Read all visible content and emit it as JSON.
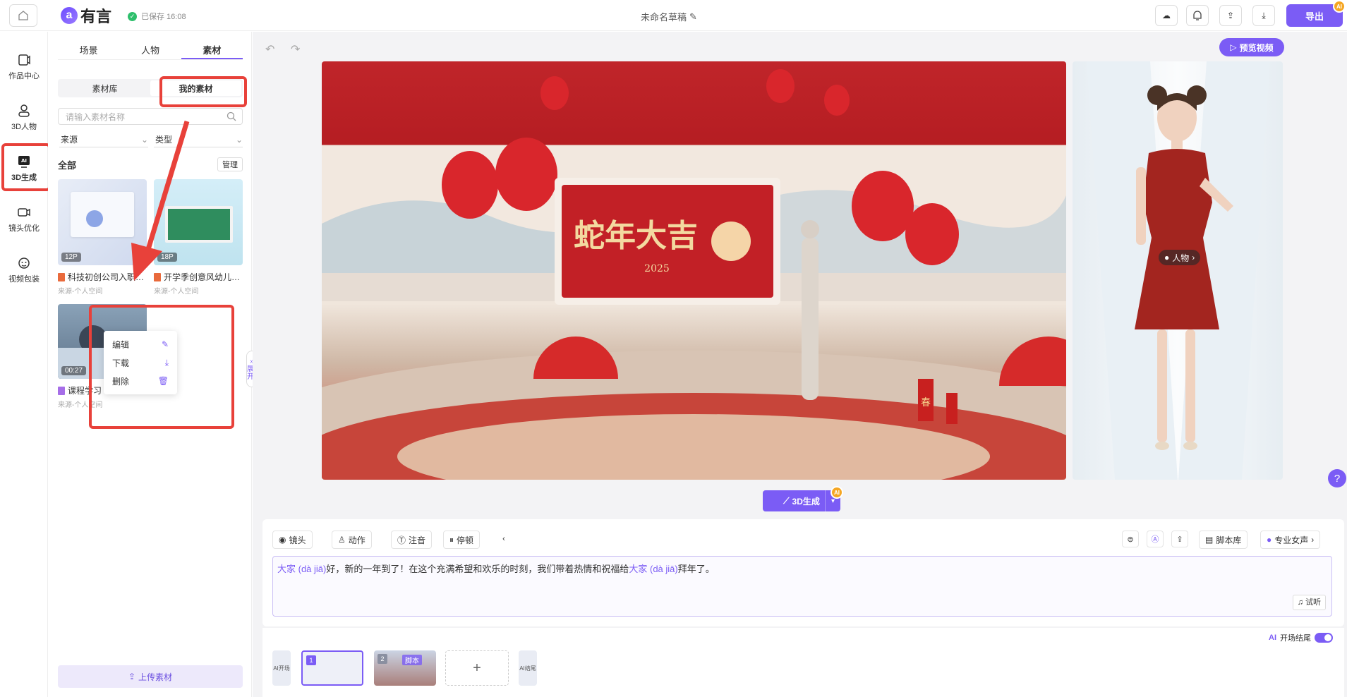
{
  "app": {
    "name": "有言",
    "saved_status": "已保存 16:08",
    "doc_title": "未命名草稿",
    "export_label": "导出",
    "ai_badge": "AI"
  },
  "leftnav": {
    "items": [
      {
        "label": "作品中心"
      },
      {
        "label": "3D人物"
      },
      {
        "label": "3D生成"
      },
      {
        "label": "镜头优化"
      },
      {
        "label": "视频包装"
      }
    ]
  },
  "panel": {
    "tabs": [
      "场景",
      "人物",
      "素材"
    ],
    "active_tab": "素材",
    "segments": [
      "素材库",
      "我的素材"
    ],
    "search_placeholder": "请输入素材名称",
    "filter_source": "来源",
    "filter_type": "类型",
    "section_label": "全部",
    "manage_label": "管理",
    "cards": [
      {
        "badge": "12P",
        "name": "科技初创公司入职…",
        "source": "来源-个人空间"
      },
      {
        "badge": "18P",
        "name": "开学季创意风幼儿…",
        "source": "来源-个人空间"
      },
      {
        "badge": "00:27",
        "name": "课程学习",
        "source": "来源-个人空间"
      }
    ],
    "context_menu": [
      "编辑",
      "下载",
      "删除"
    ],
    "upload_label": "上传素材",
    "expand_label": "展开"
  },
  "stage": {
    "preview_label": "预览视频",
    "scene_banner": "蛇年大吉",
    "scene_year": "2025",
    "scene_sign": "春",
    "person_tag": "人物",
    "generate_label": "3D生成"
  },
  "editor": {
    "tools": [
      "镜头",
      "动作",
      "注音",
      "停顿"
    ],
    "script_lib": "脚本库",
    "voice": "专业女声",
    "text_parts": [
      {
        "t": "大家 (dà jiā)",
        "hl": true
      },
      {
        "t": "好，新的一年到了！在这个充满希望和欢乐的时刻，我们带着热情和祝福给",
        "hl": false
      },
      {
        "t": "大家 (dà jiā)",
        "hl": true
      },
      {
        "t": "拜年了。",
        "hl": false
      }
    ],
    "trial_label": "试听"
  },
  "timeline": {
    "ai_start": "AI开场",
    "ai_end": "AI结尾",
    "clips": [
      {
        "num": "1"
      },
      {
        "num": "2",
        "tag": "脚本"
      }
    ],
    "toggle_label": "开场结尾",
    "add_label": "+"
  },
  "help_label": "?",
  "colors": {
    "accent": "#7b5cf5",
    "annotation": "#e8413a"
  }
}
